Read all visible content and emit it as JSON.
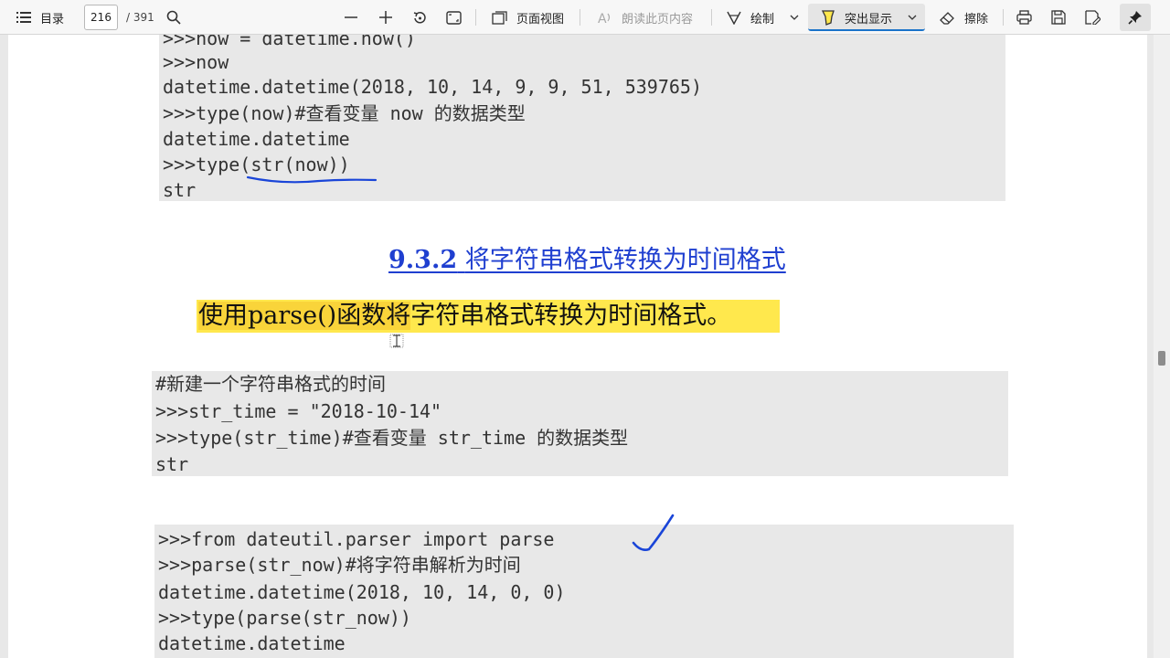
{
  "toolbar": {
    "toc_label": "目录",
    "page_current": "216",
    "page_total": "/ 391",
    "page_view_label": "页面视图",
    "read_aloud_label": "朗读此页内容",
    "draw_label": "绘制",
    "highlight_label": "突出显示",
    "erase_label": "擦除"
  },
  "document": {
    "code_block_1": [
      ">>>now = datetime.now()",
      ">>>now",
      "datetime.datetime(2018, 10, 14, 9, 9, 51, 539765)",
      ">>>type(now)#查看变量 now 的数据类型",
      "datetime.datetime",
      ">>>type(str(now))",
      "str"
    ],
    "section_number": "9.3.2",
    "section_title": "将字符串格式转换为时间格式",
    "paragraph_part1": "使用parse()函数将",
    "paragraph_part2": "字符串格式转换为时间格式。",
    "code_block_2": [
      "#新建一个字符串格式的时间",
      ">>>str_time = \"2018-10-14\"",
      ">>>type(str_time)#查看变量 str_time 的数据类型",
      "str"
    ],
    "code_block_3": [
      ">>>from dateutil.parser import parse",
      ">>>parse(str_now)#将字符串解析为时间",
      "datetime.datetime(2018, 10, 14, 0, 0)",
      ">>>type(parse(str_now))",
      "datetime.datetime"
    ]
  },
  "colors": {
    "heading_link": "#1f3fd0",
    "highlight_yellow": "#ffe84d",
    "ink_blue": "#1a45d8",
    "code_background": "#e8e8e8"
  },
  "icons": [
    "toc-icon",
    "search-icon",
    "zoom-out-icon",
    "zoom-in-icon",
    "rotate-icon",
    "fit-page-icon",
    "page-view-icon",
    "read-aloud-icon",
    "draw-icon",
    "chevron-down-icon",
    "highlighter-icon",
    "eraser-icon",
    "print-icon",
    "save-icon",
    "save-as-icon",
    "pin-icon"
  ]
}
